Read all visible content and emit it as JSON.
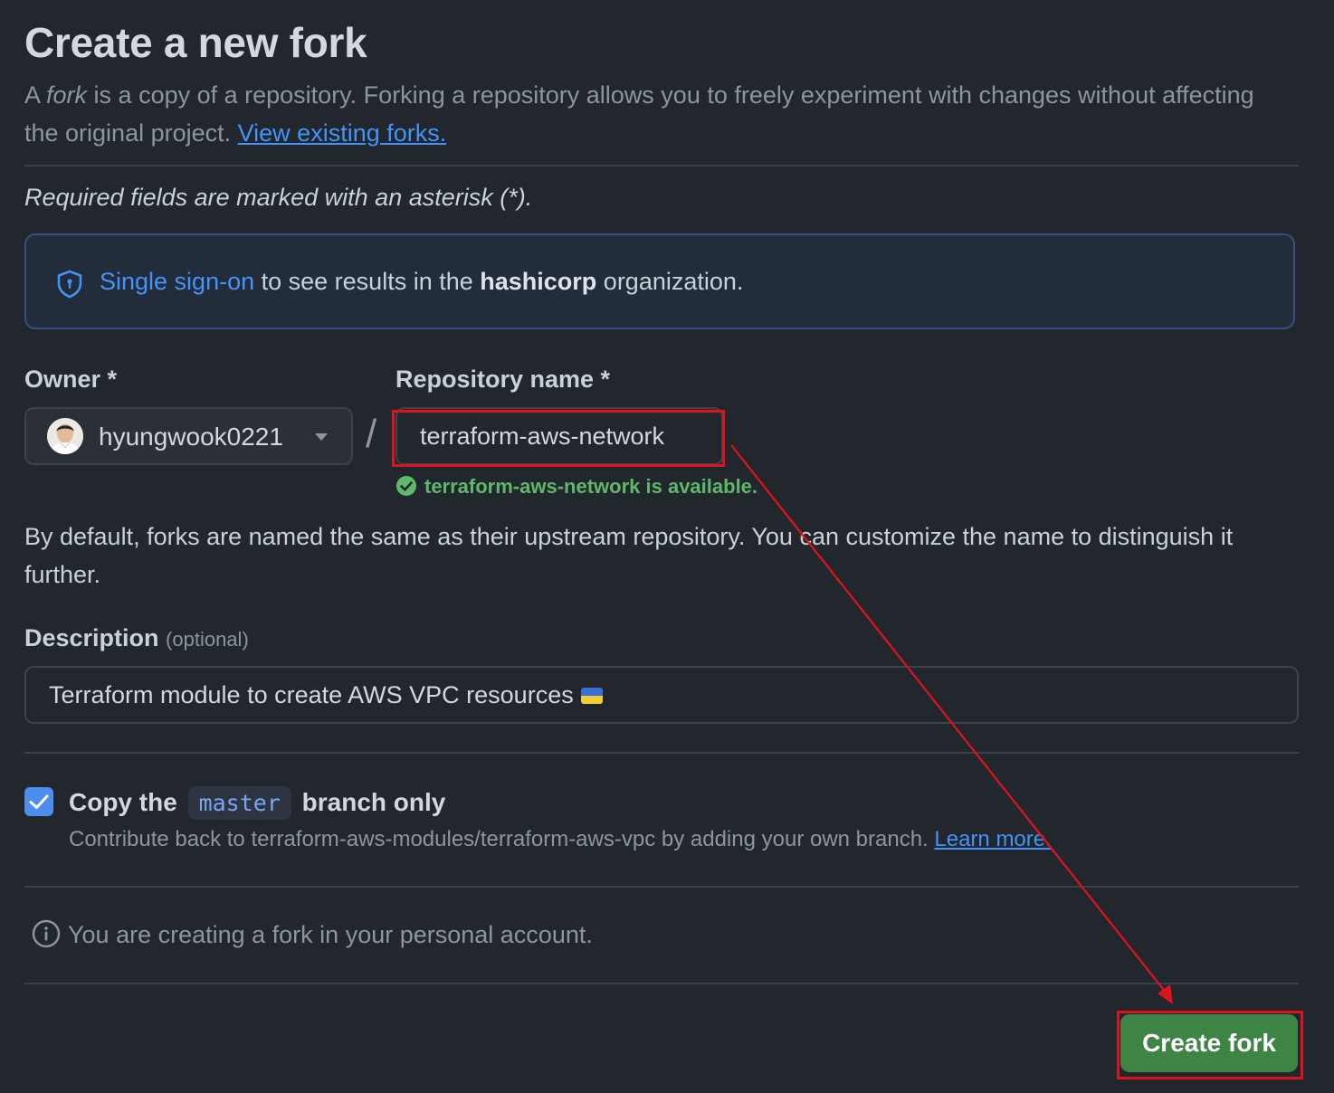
{
  "page": {
    "title": "Create a new fork",
    "intro_prefix": "A ",
    "intro_fork_word": "fork",
    "intro_text": " is a copy of a repository. Forking a repository allows you to freely experiment with changes without affecting the original project. ",
    "view_forks_link": "View existing forks.",
    "required_note": "Required fields are marked with an asterisk (*)."
  },
  "sso_banner": {
    "link": "Single sign-on",
    "text_before_org": " to see results in the ",
    "org": "hashicorp",
    "text_after_org": " organization.",
    "icon": "shield-icon"
  },
  "owner": {
    "label": "Owner *",
    "value": "hyungwook0221",
    "icon": "chevron-down-icon"
  },
  "separator": "/",
  "repository": {
    "label": "Repository name *",
    "value": "terraform-aws-network",
    "availability": "terraform-aws-network is available."
  },
  "helper_text": "By default, forks are named the same as their upstream repository. You can customize the name to distinguish it further.",
  "description": {
    "label": "Description",
    "optional": "(optional)",
    "value": "Terraform module to create AWS VPC resources"
  },
  "copy_branch": {
    "checked": true,
    "prefix": "Copy the",
    "branch": "master",
    "suffix": "branch only",
    "sub_text": "Contribute back to terraform-aws-modules/terraform-aws-vpc by adding your own branch. ",
    "learn_more": "Learn more."
  },
  "info_text": "You are creating a fork in your personal account.",
  "create_button": "Create fork",
  "colors": {
    "background": "#22262d",
    "accent_link": "#4493f8",
    "success": "#5fb86a",
    "primary_button": "#3e8545",
    "annotation": "#e0131d"
  }
}
